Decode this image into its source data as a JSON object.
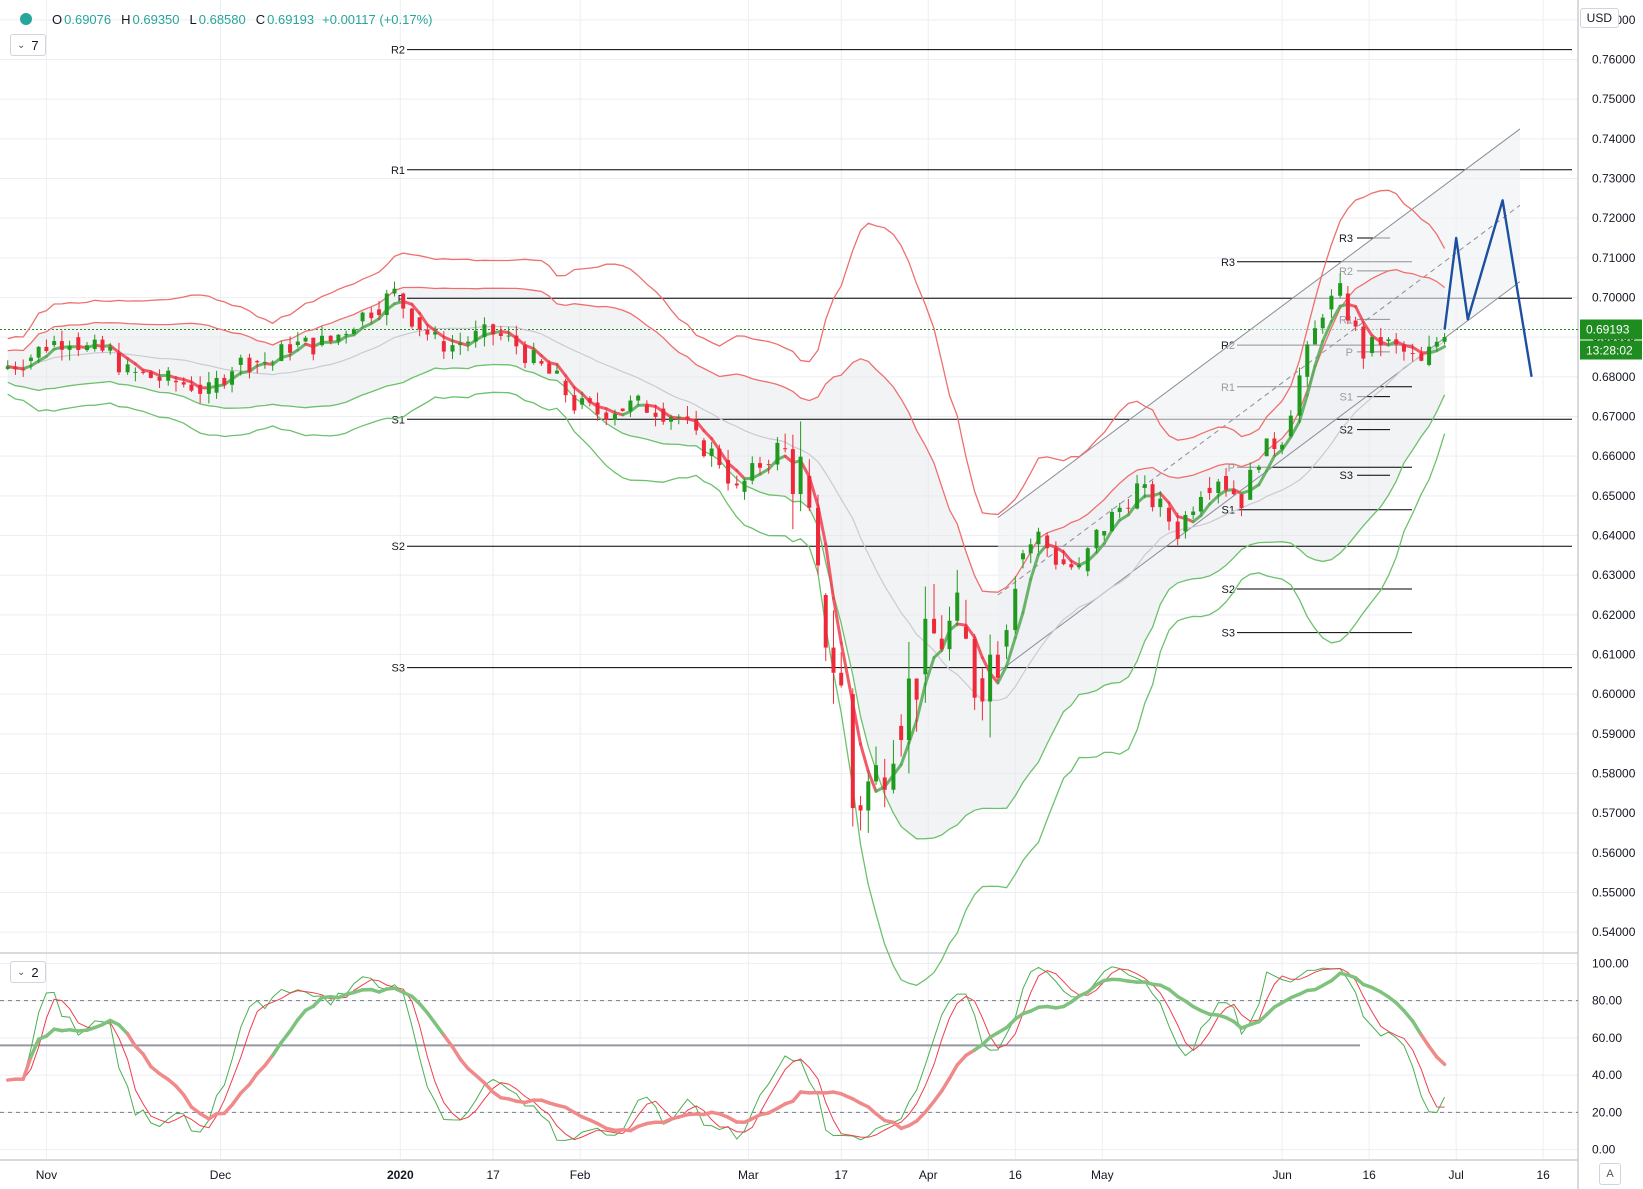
{
  "header": {
    "open_label": "O",
    "open": "0.69076",
    "high_label": "H",
    "high": "0.69350",
    "low_label": "L",
    "low": "0.68580",
    "close_label": "C",
    "close": "0.69193",
    "change": "+0.00117 (+0.17%)",
    "status_color": "#26a69a"
  },
  "main_toggle": {
    "count": "7"
  },
  "osc_toggle": {
    "count": "2"
  },
  "currency": "USD",
  "auto_label": "A",
  "price_tag": {
    "value": "0.69193",
    "countdown": "13:28:02",
    "color": "#1e8c1e"
  },
  "chart_data": [
    {
      "type": "candlestick",
      "ylim": [
        0.535,
        0.775
      ],
      "yticks": [
        0.54,
        0.55,
        0.56,
        0.57,
        0.58,
        0.59,
        0.6,
        0.61,
        0.62,
        0.63,
        0.64,
        0.65,
        0.66,
        0.67,
        0.68,
        0.69,
        0.7,
        0.71,
        0.72,
        0.73,
        0.74,
        0.75,
        0.76,
        0.77
      ],
      "x_ticks": [
        {
          "label": "Nov",
          "date": "2019-11-01"
        },
        {
          "label": "Dec",
          "date": "2019-12-01"
        },
        {
          "label": "2020",
          "date": "2020-01-01"
        },
        {
          "label": "17",
          "date": "2020-01-17"
        },
        {
          "label": "Feb",
          "date": "2020-02-01"
        },
        {
          "label": "Mar",
          "date": "2020-03-01"
        },
        {
          "label": "17",
          "date": "2020-03-17"
        },
        {
          "label": "Apr",
          "date": "2020-04-01"
        },
        {
          "label": "16",
          "date": "2020-04-16"
        },
        {
          "label": "May",
          "date": "2020-05-01"
        },
        {
          "label": "Jun",
          "date": "2020-06-01"
        },
        {
          "label": "16",
          "date": "2020-06-16"
        },
        {
          "label": "Jul",
          "date": "2020-07-01"
        },
        {
          "label": "16",
          "date": "2020-07-16"
        }
      ],
      "grid": true,
      "colors": {
        "up": "#1f9a1f",
        "down": "#ee2a3a",
        "upper_band": "#ef6f6f",
        "lower_band": "#6cc16c",
        "projection": "#1d4fa0",
        "pivot": "#000000"
      },
      "close_series": [
        [
          "2019-10-24",
          0.682
        ],
        [
          "2019-10-28",
          0.684
        ],
        [
          "2019-11-01",
          0.688
        ],
        [
          "2019-11-05",
          0.69
        ],
        [
          "2019-11-08",
          0.687
        ],
        [
          "2019-11-12",
          0.686
        ],
        [
          "2019-11-15",
          0.681
        ],
        [
          "2019-11-19",
          0.68
        ],
        [
          "2019-11-22",
          0.679
        ],
        [
          "2019-11-26",
          0.678
        ],
        [
          "2019-11-29",
          0.676
        ],
        [
          "2019-12-03",
          0.683
        ],
        [
          "2019-12-06",
          0.684
        ],
        [
          "2019-12-10",
          0.684
        ],
        [
          "2019-12-13",
          0.688
        ],
        [
          "2019-12-17",
          0.688
        ],
        [
          "2019-12-20",
          0.689
        ],
        [
          "2019-12-24",
          0.694
        ],
        [
          "2019-12-27",
          0.697
        ],
        [
          "2019-12-31",
          0.701
        ],
        [
          "2020-01-03",
          0.695
        ],
        [
          "2020-01-07",
          0.689
        ],
        [
          "2020-01-10",
          0.688
        ],
        [
          "2020-01-14",
          0.69
        ],
        [
          "2020-01-17",
          0.691
        ],
        [
          "2020-01-21",
          0.688
        ],
        [
          "2020-01-24",
          0.684
        ],
        [
          "2020-01-28",
          0.679
        ],
        [
          "2020-01-31",
          0.673
        ],
        [
          "2020-02-04",
          0.671
        ],
        [
          "2020-02-07",
          0.672
        ],
        [
          "2020-02-11",
          0.673
        ],
        [
          "2020-02-14",
          0.672
        ],
        [
          "2020-02-18",
          0.67
        ],
        [
          "2020-02-21",
          0.664
        ],
        [
          "2020-02-25",
          0.659
        ],
        [
          "2020-02-28",
          0.651
        ],
        [
          "2020-03-03",
          0.658
        ],
        [
          "2020-03-06",
          0.662
        ],
        [
          "2020-03-10",
          0.655
        ],
        [
          "2020-03-13",
          0.625
        ],
        [
          "2020-03-17",
          0.6
        ],
        [
          "2020-03-19",
          0.572
        ],
        [
          "2020-03-23",
          0.579
        ],
        [
          "2020-03-26",
          0.592
        ],
        [
          "2020-03-30",
          0.605
        ],
        [
          "2020-04-02",
          0.614
        ],
        [
          "2020-04-06",
          0.617
        ],
        [
          "2020-04-09",
          0.604
        ],
        [
          "2020-04-13",
          0.612
        ],
        [
          "2020-04-16",
          0.634
        ],
        [
          "2020-04-20",
          0.64
        ],
        [
          "2020-04-23",
          0.634
        ],
        [
          "2020-04-27",
          0.631
        ],
        [
          "2020-04-30",
          0.64
        ],
        [
          "2020-05-04",
          0.647
        ],
        [
          "2020-05-07",
          0.652
        ],
        [
          "2020-05-11",
          0.647
        ],
        [
          "2020-05-14",
          0.641
        ],
        [
          "2020-05-18",
          0.652
        ],
        [
          "2020-05-21",
          0.655
        ],
        [
          "2020-05-25",
          0.649
        ],
        [
          "2020-05-28",
          0.66
        ],
        [
          "2020-06-01",
          0.665
        ],
        [
          "2020-06-04",
          0.68
        ],
        [
          "2020-06-08",
          0.697
        ],
        [
          "2020-06-11",
          0.701
        ],
        [
          "2020-06-15",
          0.686
        ],
        [
          "2020-06-18",
          0.689
        ],
        [
          "2020-06-22",
          0.686
        ],
        [
          "2020-06-25",
          0.683
        ],
        [
          "2020-06-29",
          0.692
        ]
      ],
      "pivot_levels_yearly": [
        {
          "label": "R2",
          "value": 0.7625
        },
        {
          "label": "R1",
          "value": 0.7322
        },
        {
          "label": "P",
          "value": 0.6998
        },
        {
          "label": "S1",
          "value": 0.6693
        },
        {
          "label": "S2",
          "value": 0.6373
        },
        {
          "label": "S3",
          "value": 0.6067
        }
      ],
      "pivot_levels_monthly": [
        {
          "label": "R3",
          "value": 0.709
        },
        {
          "label": "R2",
          "value": 0.688
        },
        {
          "label": "R1",
          "value": 0.6775
        },
        {
          "label": "P",
          "value": 0.6572
        },
        {
          "label": "S1",
          "value": 0.6465
        },
        {
          "label": "S2",
          "value": 0.6265
        },
        {
          "label": "S3",
          "value": 0.6155
        }
      ],
      "pivot_levels_weekly": [
        {
          "label": "R3",
          "value": 0.715
        },
        {
          "label": "R2",
          "value": 0.7067
        },
        {
          "label": "R1",
          "value": 0.6945
        },
        {
          "label": "P",
          "value": 0.6863
        },
        {
          "label": "S1",
          "value": 0.675
        },
        {
          "label": "S2",
          "value": 0.6667
        },
        {
          "label": "S3",
          "value": 0.6552
        }
      ],
      "current_price": 0.69193,
      "projection_path": [
        [
          "2020-06-29",
          0.6919
        ],
        [
          "2020-07-01",
          0.715
        ],
        [
          "2020-07-03",
          0.6945
        ],
        [
          "2020-07-09",
          0.7245
        ],
        [
          "2020-07-14",
          0.68
        ]
      ]
    },
    {
      "type": "line",
      "ylim": [
        -5,
        105
      ],
      "yticks": [
        0,
        20,
        40,
        60,
        80,
        100
      ],
      "tick_labels": [
        "0.00",
        "20.00",
        "40.00",
        "60.00",
        "80.00",
        "100.00"
      ],
      "reference_levels": [
        80,
        20
      ],
      "baseline": 56,
      "latest_value": 59
    }
  ]
}
